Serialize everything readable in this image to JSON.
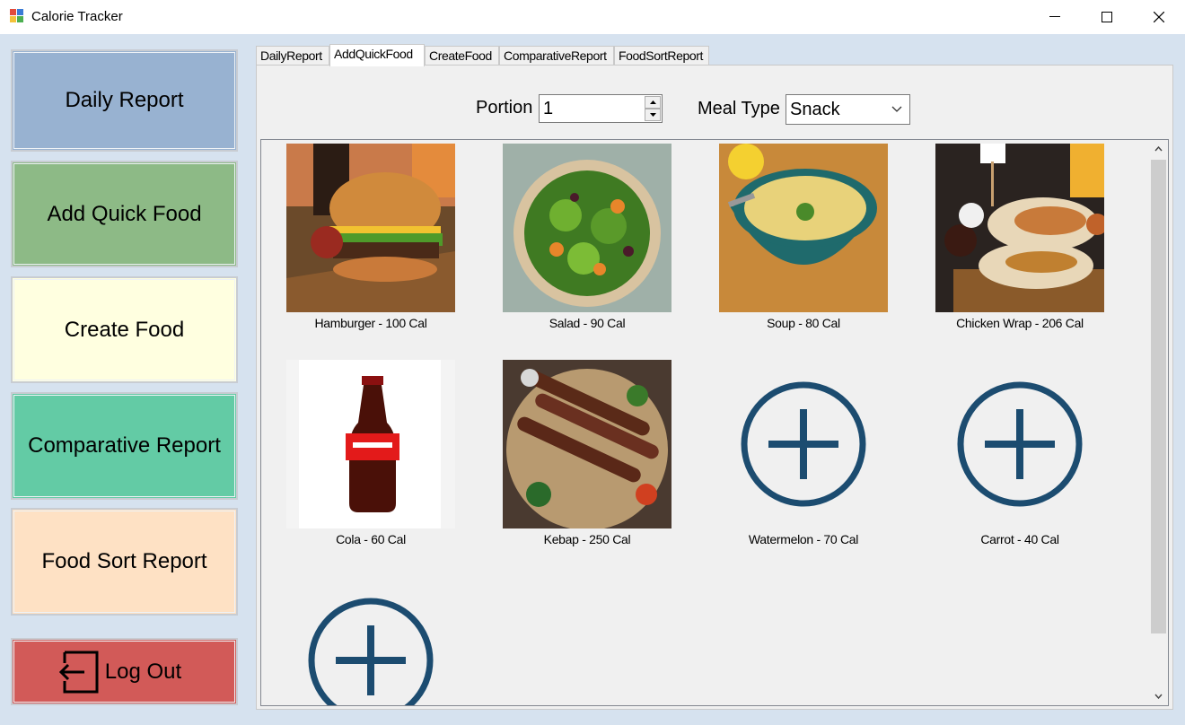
{
  "window": {
    "title": "Calorie Tracker"
  },
  "sidebar": {
    "buttons": [
      {
        "label": "Daily Report",
        "color": "#98b2d1"
      },
      {
        "label": "Add Quick Food",
        "color": "#8dba86"
      },
      {
        "label": "Create Food",
        "color": "#ffffe0"
      },
      {
        "label": "Comparative Report",
        "color": "#63cba5"
      },
      {
        "label": "Food Sort Report",
        "color": "#fee1c4"
      }
    ],
    "logout": {
      "label": "Log Out",
      "color": "#d25a58"
    }
  },
  "tabs": [
    "DailyReport",
    "AddQuickFood",
    "CreateFood",
    "ComparativeReport",
    "FoodSortReport"
  ],
  "active_tab": "AddQuickFood",
  "form": {
    "portion_label": "Portion",
    "portion_value": "1",
    "meal_label": "Meal Type",
    "meal_value": "Snack"
  },
  "foods": [
    {
      "caption": "Hamburger - 100 Cal",
      "image": "hamburger-photo"
    },
    {
      "caption": "Salad - 90 Cal",
      "image": "salad-photo"
    },
    {
      "caption": "Soup - 80 Cal",
      "image": "soup-photo"
    },
    {
      "caption": "Chicken Wrap - 206 Cal",
      "image": "chicken-wrap-photo"
    },
    {
      "caption": "Cola - 60 Cal",
      "image": "cola-photo"
    },
    {
      "caption": "Kebap - 250 Cal",
      "image": "kebap-photo"
    },
    {
      "caption": "Watermelon - 70 Cal",
      "image": "add-icon"
    },
    {
      "caption": "Carrot - 40 Cal",
      "image": "add-icon"
    },
    {
      "caption": "",
      "image": "add-icon"
    }
  ],
  "colors": {
    "client_bg": "#d6e2ef",
    "plus_icon": "#1c4c70"
  }
}
